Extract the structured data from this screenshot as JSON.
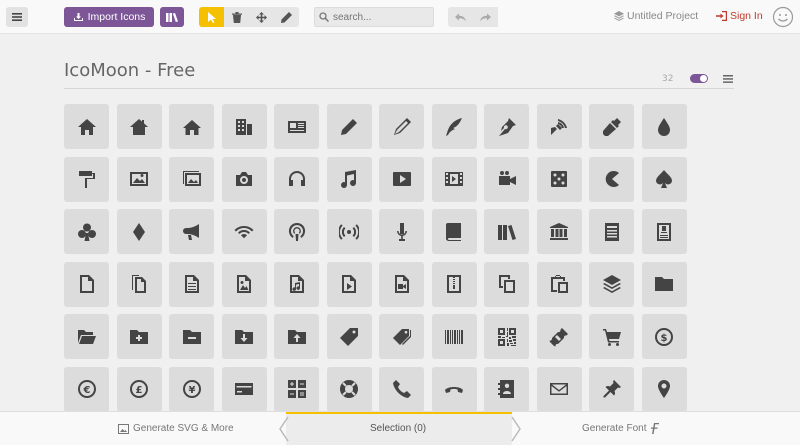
{
  "toolbar": {
    "import_label": "Import Icons",
    "search_placeholder": "search...",
    "project_label": "Untitled Project",
    "signin_label": "Sign In"
  },
  "set": {
    "title": "IcoMoon - Free",
    "grid_size": "32"
  },
  "icons": [
    "home",
    "home2",
    "home3",
    "office",
    "newspaper",
    "pencil",
    "pencil2",
    "quill",
    "pen",
    "blog",
    "eyedropper",
    "droplet",
    "paint-format",
    "image",
    "images",
    "camera",
    "headphones",
    "music",
    "play",
    "film",
    "video-camera",
    "dice",
    "pacman",
    "spades",
    "clubs",
    "diamonds",
    "bullhorn",
    "connection",
    "podcast",
    "feed",
    "mic",
    "book",
    "books",
    "library",
    "file-text",
    "profile",
    "file-empty",
    "files-empty",
    "file-text2",
    "file-picture",
    "file-music",
    "file-play",
    "file-video",
    "file-zip",
    "copy",
    "paste",
    "stack",
    "folder",
    "folder-open",
    "folder-plus",
    "folder-minus",
    "folder-download",
    "folder-upload",
    "price-tag",
    "price-tags",
    "barcode",
    "qrcode",
    "ticket",
    "cart",
    "coin-dollar",
    "coin-euro",
    "coin-pound",
    "coin-yen",
    "credit-card",
    "calculator",
    "lifebuoy",
    "phone",
    "phone-hang-up",
    "address-book",
    "envelop",
    "pushpin",
    "location"
  ],
  "bottom": {
    "left_label": "Generate SVG & More",
    "mid_label": "Selection (0)",
    "right_label": "Generate Font"
  },
  "colors": {
    "accent": "#7c5696",
    "highlight": "#f4c000",
    "signin": "#c0392b"
  }
}
